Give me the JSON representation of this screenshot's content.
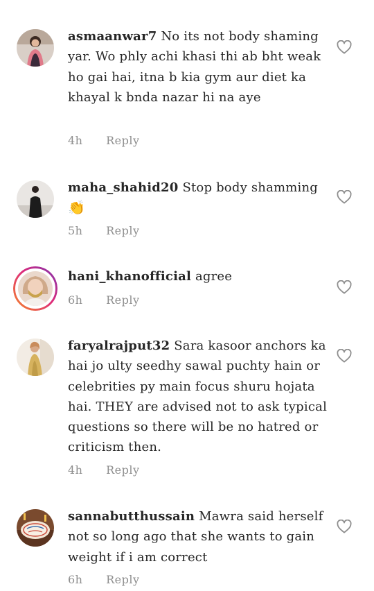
{
  "comments": [
    {
      "username": "asmaanwar7",
      "text": "No its not body shaming yar. Wo phly achi khasi thi ab bht weak ho gai hai, itna b kia gym aur diet ka khayal k bnda nazar hi na aye",
      "time": "4h",
      "reply_label": "Reply",
      "avatar_icon": "avatar-woman-icon"
    },
    {
      "username": "maha_shahid20",
      "text": "Stop body shamming",
      "emoji": "👏",
      "time": "5h",
      "reply_label": "Reply",
      "avatar_icon": "avatar-woman-black-dress-icon"
    },
    {
      "username": "hani_khanofficial",
      "text": "agree",
      "time": "6h",
      "reply_label": "Reply",
      "avatar_icon": "avatar-story-ring-icon",
      "story_ring_colors": [
        "#f58529",
        "#dd2a7b",
        "#8134af"
      ]
    },
    {
      "username": "faryalrajput32",
      "text": "Sara kasoor anchors ka hai jo ulty seedhy sawal puchty hain or celebrities py main focus shuru hojata hai. THEY are advised not to ask typical questions so there will be no hatred or criticism then.",
      "time": "4h",
      "reply_label": "Reply",
      "avatar_icon": "avatar-woman-gold-dress-icon"
    },
    {
      "username": "sannabutthussain",
      "text": "Mawra said herself not so long ago that she wants to gain weight if i am correct",
      "time": "6h",
      "reply_label": "Reply",
      "avatar_icon": "avatar-birthday-cake-icon"
    }
  ],
  "icons": {
    "like": "heart-outline-icon"
  },
  "colors": {
    "text": "#262626",
    "meta": "#8e8e8e",
    "heart": "#8e8e8e"
  }
}
